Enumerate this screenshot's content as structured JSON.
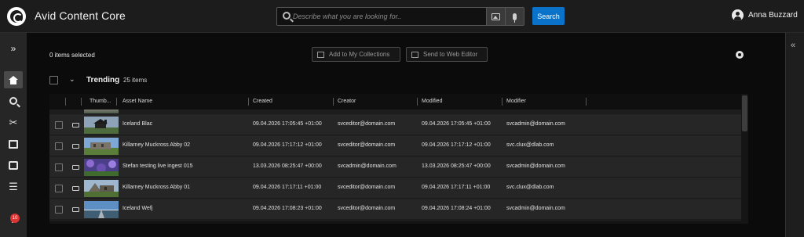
{
  "app": {
    "title": "Avid Content Core"
  },
  "search": {
    "placeholder": "Describe what you are looking for..",
    "button_label": "Search"
  },
  "user": {
    "name": "Anna Buzzard"
  },
  "leftnav": {
    "items": [
      {
        "icon": "expand-icon"
      },
      {
        "icon": "home-icon",
        "active": true
      },
      {
        "icon": "search-icon"
      },
      {
        "icon": "tools-icon"
      },
      {
        "icon": "collections-icon"
      },
      {
        "icon": "comments-icon"
      },
      {
        "icon": "list-icon"
      },
      {
        "icon": "notifications-icon"
      }
    ],
    "notification_count": "10"
  },
  "toolbar": {
    "selection_label": "0 items selected",
    "add_collections_label": "Add to My Collections",
    "send_web_editor_label": "Send to Web Editor"
  },
  "section": {
    "title": "Trending",
    "count": "25 items"
  },
  "table": {
    "columns": [
      "Thumb...",
      "Asset Name",
      "Created",
      "Creator",
      "Modified",
      "Modifier"
    ],
    "rows": [
      {
        "name": "Iceland Blac",
        "created": "09.04.2026 17:05:45 +01:00",
        "creator": "svceditor@domain.com",
        "modified": "09.04.2026 17:05:45 +01:00",
        "modifier": "svcadmin@domain.com",
        "thumb": "church"
      },
      {
        "name": "Killarney Muckross Abby 02",
        "created": "09.04.2026 17:17:12 +01:00",
        "creator": "svceditor@domain.com",
        "modified": "09.04.2026 17:17:12 +01:00",
        "modifier": "svc.clux@dlab.com",
        "thumb": "ruins"
      },
      {
        "name": "Stefan testing live ingest 015",
        "created": "13.03.2026 08:25:47 +00:00",
        "creator": "svcadmin@domain.com",
        "modified": "13.03.2026 08:25:47 +00:00",
        "modifier": "svcadmin@domain.com",
        "thumb": "flowers"
      },
      {
        "name": "Killarney Muckross Abby 01",
        "created": "09.04.2026 17:17:11 +01:00",
        "creator": "svceditor@domain.com",
        "modified": "09.04.2026 17:17:11 +01:00",
        "modifier": "svc.clux@dlab.com",
        "thumb": "abbey"
      },
      {
        "name": "Iceland Wefj",
        "created": "09.04.2026 17:08:23 +01:00",
        "creator": "svceditor@domain.com",
        "modified": "09.04.2026 17:08:24 +01:00",
        "modifier": "svcadmin@domain.com",
        "thumb": "road"
      }
    ]
  },
  "colors": {
    "accent": "#0b72c9",
    "badge": "#dd3333"
  }
}
